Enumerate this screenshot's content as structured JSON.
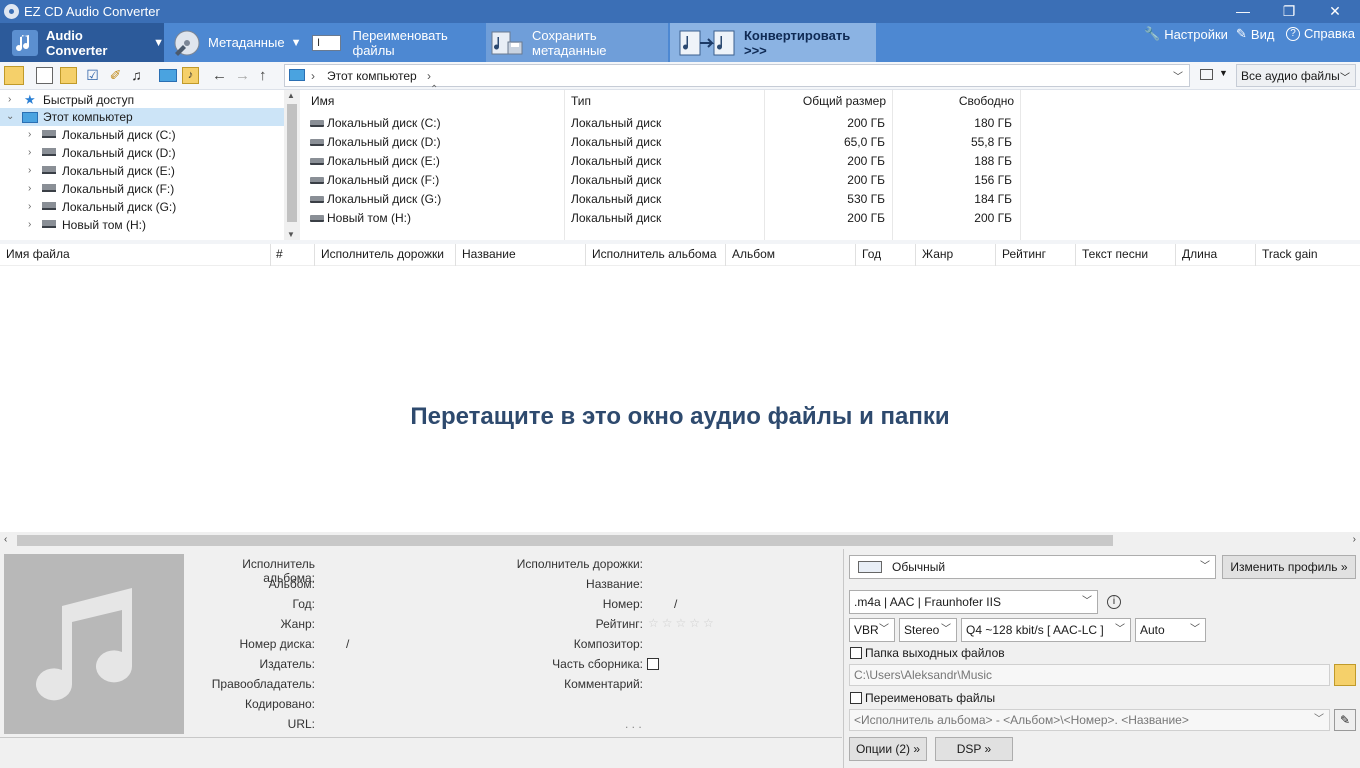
{
  "window": {
    "title": "EZ CD Audio Converter",
    "minimize": "—",
    "maximize": "❐",
    "close": "✕"
  },
  "ribbon": {
    "audio_converter": "Audio Converter",
    "metadata": "Метаданные",
    "rename_files": "Переименовать файлы",
    "save_metadata": "Сохранить метаданные",
    "convert": "Конвертировать >>>",
    "settings": "Настройки",
    "view": "Вид",
    "help": "Справка"
  },
  "address": {
    "path": "Этот компьютер",
    "filter": "Все аудио файлы"
  },
  "tree": {
    "items": [
      {
        "label": "Быстрый доступ",
        "level": 0,
        "expanded": false,
        "icon": "star-icon"
      },
      {
        "label": "Этот компьютер",
        "level": 0,
        "expanded": true,
        "selected": true,
        "icon": "computer-icon"
      },
      {
        "label": "Локальный диск (C:)",
        "level": 1,
        "icon": "drive-icon"
      },
      {
        "label": "Локальный диск (D:)",
        "level": 1,
        "icon": "drive-icon"
      },
      {
        "label": "Локальный диск (E:)",
        "level": 1,
        "icon": "drive-icon"
      },
      {
        "label": "Локальный диск (F:)",
        "level": 1,
        "icon": "drive-icon"
      },
      {
        "label": "Локальный диск (G:)",
        "level": 1,
        "icon": "drive-icon"
      },
      {
        "label": "Новый том (H:)",
        "level": 1,
        "icon": "drive-icon"
      }
    ]
  },
  "filelist": {
    "columns": {
      "name": "Имя",
      "type": "Тип",
      "total": "Общий размер",
      "free": "Свободно"
    },
    "rows": [
      {
        "name": "Локальный диск (C:)",
        "type": "Локальный диск",
        "total": "200 ГБ",
        "free": "180 ГБ"
      },
      {
        "name": "Локальный диск (D:)",
        "type": "Локальный диск",
        "total": "65,0 ГБ",
        "free": "55,8 ГБ"
      },
      {
        "name": "Локальный диск (E:)",
        "type": "Локальный диск",
        "total": "200 ГБ",
        "free": "188 ГБ"
      },
      {
        "name": "Локальный диск (F:)",
        "type": "Локальный диск",
        "total": "200 ГБ",
        "free": "156 ГБ"
      },
      {
        "name": "Локальный диск (G:)",
        "type": "Локальный диск",
        "total": "530 ГБ",
        "free": "184 ГБ"
      },
      {
        "name": "Новый том (H:)",
        "type": "Локальный диск",
        "total": "200 ГБ",
        "free": "200 ГБ"
      }
    ]
  },
  "tracks": {
    "columns": [
      "Имя файла",
      "#",
      "Исполнитель дорожки",
      "Название",
      "Исполнитель альбома",
      "Альбом",
      "Год",
      "Жанр",
      "Рейтинг",
      "Текст песни",
      "Длина",
      "Track gain"
    ],
    "drop_hint": "Перетащите в это окно аудио файлы и папки"
  },
  "metadata": {
    "album_artist": "Исполнитель альбома:",
    "album": "Альбом:",
    "year": "Год:",
    "genre": "Жанр:",
    "disc_number": "Номер диска:",
    "disc_sep": "/",
    "publisher": "Издатель:",
    "copyright": "Правообладатель:",
    "encoded_by": "Кодировано:",
    "url": "URL:",
    "track_artist": "Исполнитель дорожки:",
    "title": "Название:",
    "number": "Номер:",
    "number_sep": "/",
    "rating": "Рейтинг:",
    "rating_stars": "☆☆☆☆☆",
    "composer": "Композитор:",
    "compilation": "Часть сборника:",
    "comment": "Комментарий:",
    "ellipsis": ". . ."
  },
  "converter": {
    "profile": "Обычный",
    "change_profile": "Изменить профиль »",
    "format": ".m4a  |  AAC  |  Fraunhofer IIS",
    "mode": "VBR",
    "channels": "Stereo",
    "quality": "Q4 ~128 kbit/s [ AAC-LC ]",
    "samplerate": "Auto",
    "output_folder_label": "Папка выходных файлов",
    "output_folder": "C:\\Users\\Aleksandr\\Music",
    "rename_label": "Переименовать файлы",
    "rename_pattern": "<Исполнитель альбома> - <Альбом>\\<Номер>. <Название>",
    "options": "Опции (2) »",
    "dsp": "DSP »"
  }
}
